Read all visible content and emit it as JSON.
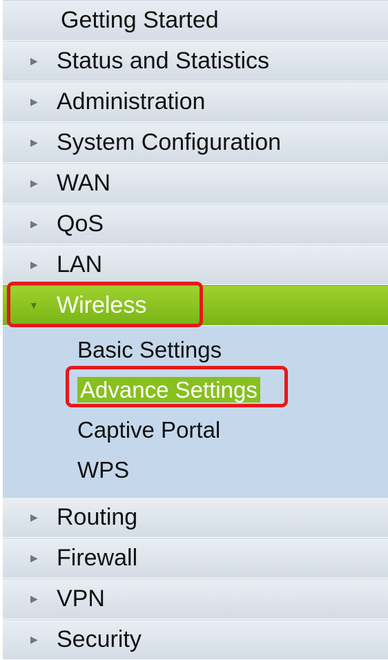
{
  "nav": {
    "header": "Getting Started",
    "items_before": [
      {
        "label": "Status and Statistics"
      },
      {
        "label": "Administration"
      },
      {
        "label": "System Configuration"
      },
      {
        "label": "WAN"
      },
      {
        "label": "QoS"
      },
      {
        "label": "LAN"
      }
    ],
    "active": {
      "label": "Wireless",
      "subitems": [
        {
          "label": "Basic Settings"
        },
        {
          "label": "Advance Settings",
          "selected": true
        },
        {
          "label": "Captive Portal"
        },
        {
          "label": "WPS"
        }
      ]
    },
    "items_after": [
      {
        "label": "Routing"
      },
      {
        "label": "Firewall"
      },
      {
        "label": "VPN"
      },
      {
        "label": "Security"
      }
    ]
  },
  "icons": {
    "collapsed": "triangle-right-icon",
    "expanded": "triangle-down-icon"
  },
  "colors": {
    "active_green": "#87c01f",
    "submenu_bg": "#c5d8eb",
    "highlight_red": "#e5181b"
  }
}
